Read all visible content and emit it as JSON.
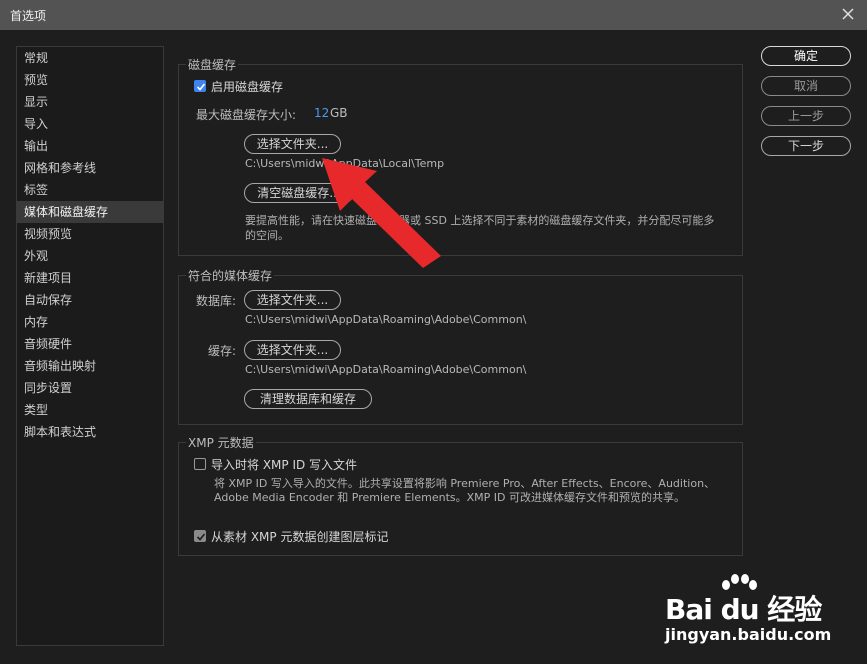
{
  "window": {
    "title": "首选项"
  },
  "sidebar": {
    "items": [
      {
        "label": "常规"
      },
      {
        "label": "预览"
      },
      {
        "label": "显示"
      },
      {
        "label": "导入"
      },
      {
        "label": "输出"
      },
      {
        "label": "网格和参考线"
      },
      {
        "label": "标签"
      },
      {
        "label": "媒体和磁盘缓存",
        "selected": true
      },
      {
        "label": "视频预览"
      },
      {
        "label": "外观"
      },
      {
        "label": "新建项目"
      },
      {
        "label": "自动保存"
      },
      {
        "label": "内存"
      },
      {
        "label": "音频硬件"
      },
      {
        "label": "音频输出映射"
      },
      {
        "label": "同步设置"
      },
      {
        "label": "类型"
      },
      {
        "label": "脚本和表达式"
      }
    ]
  },
  "buttons": {
    "ok": "确定",
    "cancel": "取消",
    "previous": "上一步",
    "next": "下一步"
  },
  "disk_cache": {
    "title": "磁盘缓存",
    "enable_label": "启用磁盘缓存",
    "enable_checked": true,
    "max_size_label": "最大磁盘缓存大小:",
    "max_size_value": "12",
    "max_size_unit": "GB",
    "choose_folder": "选择文件夹...",
    "path": "C:\\Users\\midwi\\AppData\\Local\\Temp",
    "clear_button": "清空磁盘缓存...",
    "note": "要提高性能，请在快速磁盘驱动器或 SSD 上选择不同于素材的磁盘缓存文件夹，并分配尽可能多的空间。"
  },
  "conformed_cache": {
    "title": "符合的媒体缓存",
    "database_label": "数据库:",
    "database_choose": "选择文件夹...",
    "database_path": "C:\\Users\\midwi\\AppData\\Roaming\\Adobe\\Common\\",
    "cache_label": "缓存:",
    "cache_choose": "选择文件夹...",
    "cache_path": "C:\\Users\\midwi\\AppData\\Roaming\\Adobe\\Common\\",
    "clean_button": "清理数据库和缓存"
  },
  "xmp": {
    "title": "XMP 元数据",
    "write_on_import_label": "导入时将 XMP ID 写入文件",
    "write_on_import_checked": false,
    "write_note_line1": "将 XMP ID 写入导入的文件。此共享设置将影响 Premiere Pro、After Effects、Encore、Audition、",
    "write_note_line2": "Adobe Media Encoder 和 Premiere Elements。XMP ID 可改进媒体缓存文件和预览的共享。",
    "create_markers_label": "从素材 XMP 元数据创建图层标记",
    "create_markers_checked": true
  },
  "watermark": {
    "brand": "Bai du 经验",
    "url": "jingyan.baidu.com"
  },
  "colors": {
    "accent": "#3d84f0",
    "arrow": "#e8292b",
    "link_value": "#4a9af0"
  }
}
